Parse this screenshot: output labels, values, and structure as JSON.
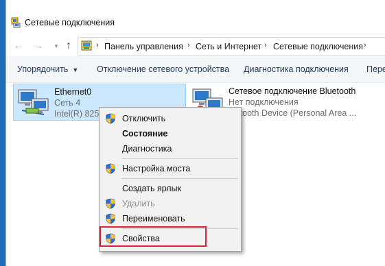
{
  "window": {
    "title": "Сетевые подключения"
  },
  "address": {
    "crumbs": [
      "Панель управления",
      "Сеть и Интернет",
      "Сетевые подключения"
    ]
  },
  "toolbar": {
    "organize": "Упорядочить",
    "disable": "Отключение сетевого устройства",
    "diagnose": "Диагностика подключения",
    "more": "Пере"
  },
  "connections": [
    {
      "name": "Ethernet0",
      "status": "Сеть 4",
      "device": "Intel(R) 825"
    },
    {
      "name": "Сетевое подключение Bluetooth",
      "status": "Нет подключения",
      "device": "luetooth Device (Personal Area ..."
    }
  ],
  "context_menu": {
    "items": [
      {
        "label": "Отключить",
        "shield": true
      },
      {
        "label": "Состояние",
        "shield": false,
        "bold": true
      },
      {
        "label": "Диагностика",
        "shield": false
      },
      {
        "label": "Настройка моста",
        "shield": true
      },
      {
        "label": "Создать ярлык",
        "shield": false
      },
      {
        "label": "Удалить",
        "shield": true,
        "disabled": true
      },
      {
        "label": "Переименовать",
        "shield": true
      },
      {
        "label": "Свойства",
        "shield": true
      }
    ]
  },
  "colors": {
    "desktop": "#1e6fb8",
    "selection": "#cce8ff",
    "highlight": "#d9232e"
  }
}
